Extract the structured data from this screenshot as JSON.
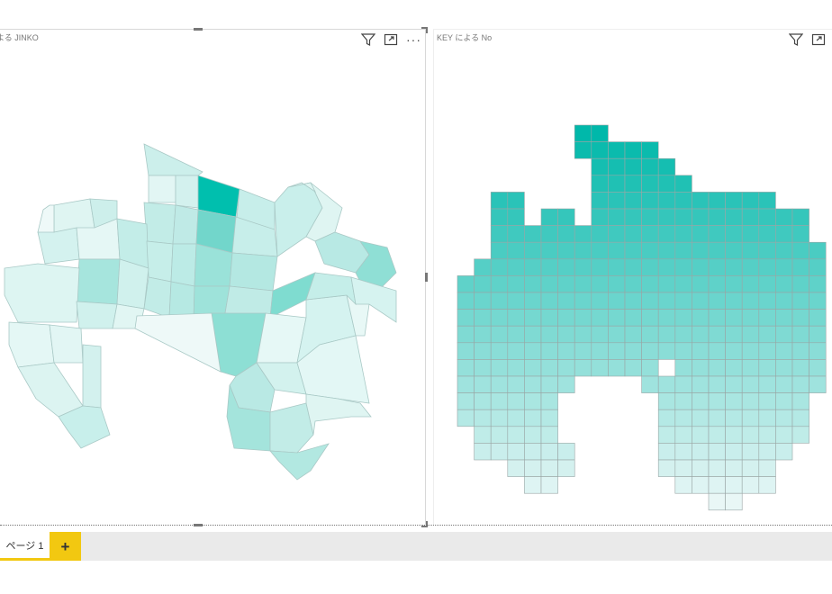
{
  "visuals": {
    "left": {
      "title": "よる JINKO",
      "icons": [
        "filter-icon",
        "focus-mode-icon",
        "more-options-icon"
      ]
    },
    "right": {
      "title": "KEY による No",
      "icons": [
        "filter-icon",
        "focus-mode-icon"
      ]
    }
  },
  "colors": {
    "accent": "#00b8a9",
    "light": "#e9f7f6",
    "tab_accent": "#f2c811"
  },
  "page_tabs": {
    "items": [
      "ページ 1"
    ],
    "add_label": "+"
  }
}
